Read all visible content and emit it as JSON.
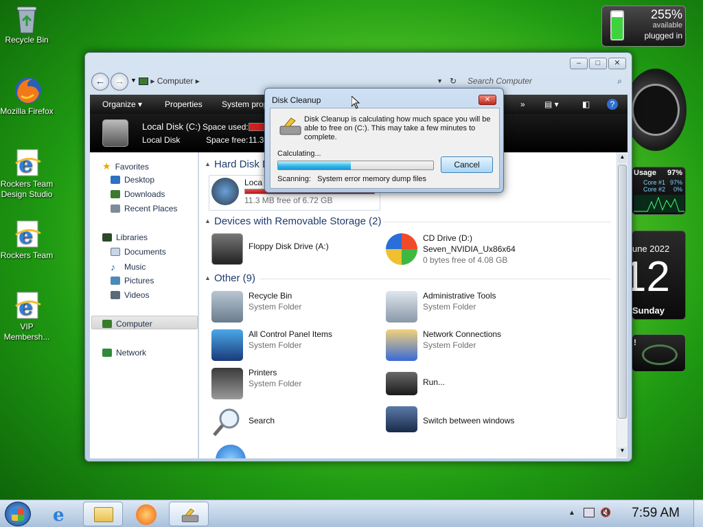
{
  "desktop": {
    "icons": [
      {
        "label": "Recycle Bin",
        "icon": "recycle-bin-icon"
      },
      {
        "label": "Mozilla Firefox",
        "icon": "firefox-icon"
      },
      {
        "label": "Rockers Team Design Studio",
        "icon": "ie-icon"
      },
      {
        "label": "Rockers Team",
        "icon": "ie-icon"
      },
      {
        "label": "VIP Membersh...",
        "icon": "ie-icon"
      }
    ]
  },
  "gadgets": {
    "battery": {
      "percent": "255%",
      "status": "available",
      "power": "plugged in"
    },
    "cpu": {
      "label": "Usage",
      "total": "97%",
      "core1_label": "Core #1",
      "core1": "97%",
      "core2_label": "Core #2",
      "core2": "0%"
    },
    "calendar": {
      "month_year": "une 2022",
      "day": "12",
      "weekday": "Sunday"
    },
    "misc": {
      "text": "!"
    }
  },
  "window": {
    "breadcrumb": "Computer",
    "search_placeholder": "Search Computer",
    "toolbar": {
      "organize": "Organize",
      "properties": "Properties",
      "system_properties": "System prop",
      "more": "»"
    },
    "details": {
      "title": "Local Disk (C:)",
      "subtitle": "Local Disk",
      "space_used_label": "Space used:",
      "space_free_label": "Space free:",
      "space_free_value": "11.3"
    },
    "nav": {
      "favorites": "Favorites",
      "desktop": "Desktop",
      "downloads": "Downloads",
      "recent": "Recent Places",
      "libraries": "Libraries",
      "documents": "Documents",
      "music": "Music",
      "pictures": "Pictures",
      "videos": "Videos",
      "computer": "Computer",
      "network": "Network"
    },
    "groups": {
      "hdd": "Hard Disk D",
      "removable": "Devices with Removable Storage (2)",
      "other": "Other (9)"
    },
    "local_disk": {
      "name": "Loca",
      "free": "11.3 MB free of 6.72 GB",
      "used_fraction": 0.998
    },
    "floppy": {
      "name": "Floppy Disk Drive (A:)"
    },
    "cd": {
      "name": "CD Drive (D:)",
      "label": "Seven_NVIDIA_Ux86x64",
      "free": "0 bytes free of 4.08 GB"
    },
    "other_items": [
      {
        "name": "Recycle Bin",
        "type": "System Folder"
      },
      {
        "name": "Administrative Tools",
        "type": "System Folder"
      },
      {
        "name": "All Control Panel Items",
        "type": "System Folder"
      },
      {
        "name": "Network Connections",
        "type": "System Folder"
      },
      {
        "name": "Printers",
        "type": "System Folder"
      },
      {
        "name": "Run...",
        "type": ""
      },
      {
        "name": "Search",
        "type": ""
      },
      {
        "name": "Switch between windows",
        "type": ""
      }
    ]
  },
  "dialog": {
    "title": "Disk Cleanup",
    "message": "Disk Cleanup is calculating how much space you will be able to free on  (C:). This may take a few minutes to complete.",
    "calculating": "Calculating...",
    "progress": 0.47,
    "scanning_label": "Scanning:",
    "scanning_item": "System error memory dump files",
    "cancel": "Cancel"
  },
  "taskbar": {
    "time": "7:59 AM"
  }
}
